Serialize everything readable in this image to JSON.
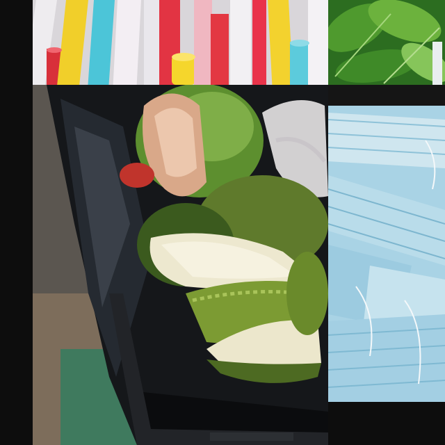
{
  "tiles": [
    {
      "name": "drinking-straws",
      "colors": [
        "#e8e6ea",
        "#f0d12b",
        "#4fc6d9",
        "#e0353f",
        "#f4f1f4"
      ]
    },
    {
      "name": "green-leaves",
      "colors": [
        "#2f7a23",
        "#5aa332",
        "#8cc86a"
      ]
    },
    {
      "name": "waste-bin-coconut-durian",
      "colors": [
        "#111316",
        "#6f9f3c",
        "#e9e3c9",
        "#3a5d1c"
      ]
    },
    {
      "name": "face-masks",
      "colors": [
        "#a8d3e6",
        "#cfe6ef",
        "#7fb9d2"
      ]
    }
  ]
}
